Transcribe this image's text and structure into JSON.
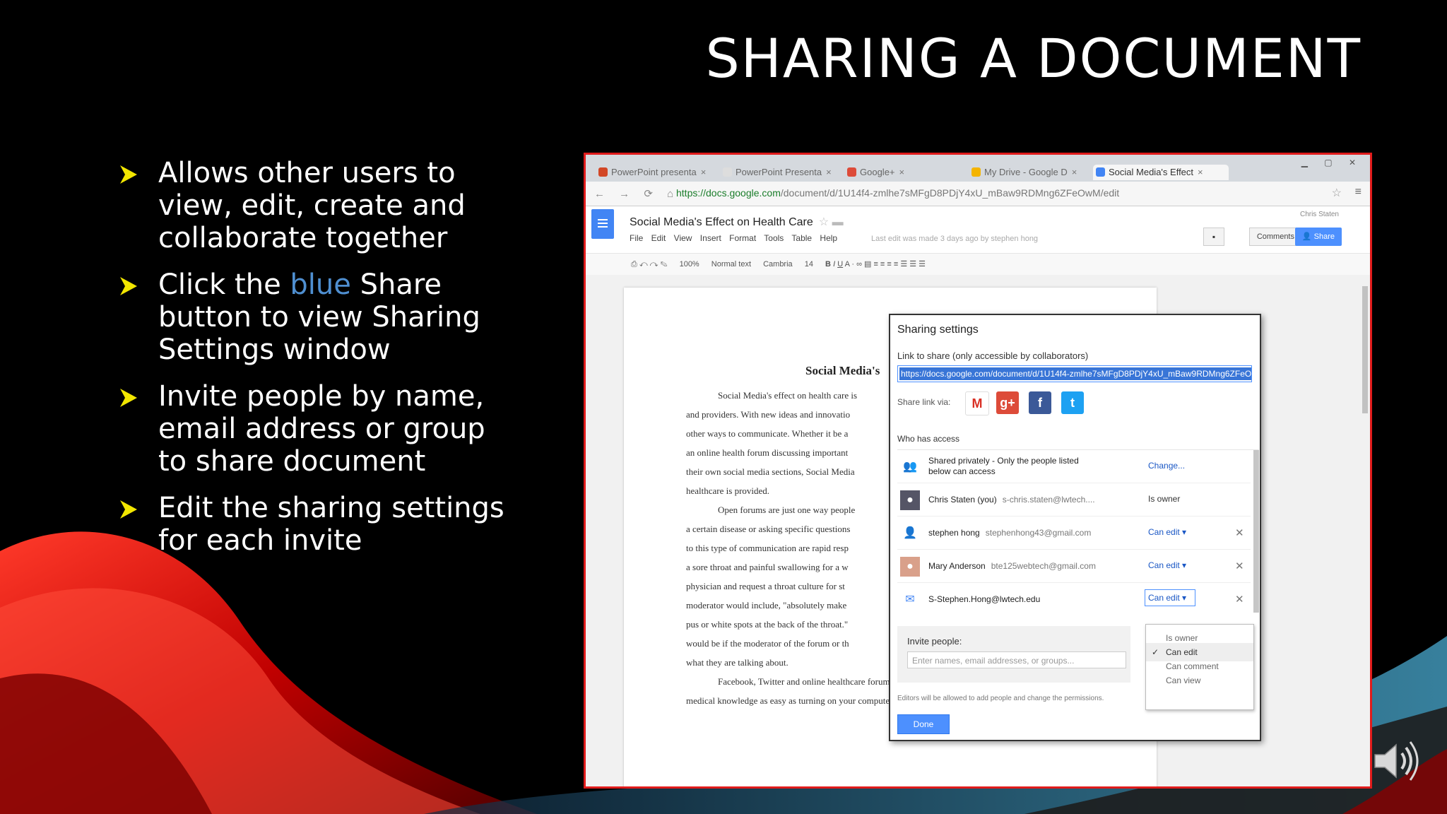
{
  "slide": {
    "title": "SHARING A DOCUMENT",
    "bullets": [
      {
        "text": "Allows other users to view, edit, create and collaborate together"
      },
      {
        "pre": "Click the ",
        "highlight": "blue",
        "post": " Share button to view Sharing Settings window"
      },
      {
        "text": "Invite people by name, email address or group to share document"
      },
      {
        "text": "Edit the sharing settings for each invite"
      }
    ],
    "colors": {
      "accent_red": "#e01b1b",
      "highlight_blue": "#4f8fd1",
      "bullet_yellow": "#f2e600"
    }
  },
  "browser": {
    "tabs": [
      "PowerPoint presenta",
      "PowerPoint Presenta",
      "Google+",
      "My Drive - Google D",
      "Social Media's Effect"
    ],
    "url_host": "https://docs.google.com",
    "url_path": "/document/d/1U14f4-zmlhe7sMFgD8PDjY4xU_mBaw9RDMng6ZFeOwM/edit"
  },
  "docs": {
    "title": "Social Media's Effect on Health Care",
    "menu": "File Edit View Insert Format Tools Table Help",
    "last_edit": "Last edit was made 3 days ago by stephen hong",
    "user": "Chris Staten",
    "comments_label": "Comments",
    "share_label": "Share",
    "toolbar": {
      "zoom": "100%",
      "style": "Normal text",
      "font": "Cambria",
      "size": "14"
    },
    "heading": "Social Media's",
    "lines": [
      "Social Media's effect on health care is",
      "and providers. With new ideas and innovatio",
      "other ways to communicate. Whether it be a",
      "an online health forum discussing important",
      "their own social media sections, Social Media",
      "healthcare is provided.",
      "Open forums are just one way people",
      "a certain disease or asking specific questions",
      "to this type of communication are rapid resp",
      "a sore throat and painful swallowing for a w",
      "physician and request a throat culture for st",
      "moderator would include, \"absolutely make",
      "pus or white spots at the back of the throat.\"",
      "would be if the moderator of the forum or th",
      "what they are talking about.",
      "Facebook, Twitter and online healthcare forums have made gaining important",
      "medical knowledge as easy as turning on your computer and accessing the Internet. A"
    ]
  },
  "dialog": {
    "title": "Sharing settings",
    "link_label": "Link to share (only accessible by collaborators)",
    "link": "https://docs.google.com/document/d/1U14f4-zmlhe7sMFgD8PDjY4xU_mBaw9RDMng6ZFeOwM/edit",
    "share_via": "Share link via:",
    "who_has_access": "Who has access",
    "privacy_line1": "Shared privately - Only the people listed",
    "privacy_line2": "below can access",
    "change": "Change...",
    "people": [
      {
        "name": "Chris Staten (you)",
        "email": "s-chris.staten@lwtech....",
        "perm": "Is owner"
      },
      {
        "name": "stephen hong",
        "email": "stephenhong43@gmail.com",
        "perm": "Can edit"
      },
      {
        "name": "Mary Anderson",
        "email": "bte125webtech@gmail.com",
        "perm": "Can edit"
      },
      {
        "name": "S-Stephen.Hong@lwtech.edu",
        "email": "",
        "perm": "Can edit"
      }
    ],
    "invite_label": "Invite people:",
    "invite_placeholder": "Enter names, email addresses, or groups...",
    "note": "Editors will be allowed to add people and change the permissions.",
    "done": "Done",
    "dropdown": [
      "Is owner",
      "Can edit",
      "Can comment",
      "Can view"
    ],
    "dropdown_selected": "Can edit"
  }
}
